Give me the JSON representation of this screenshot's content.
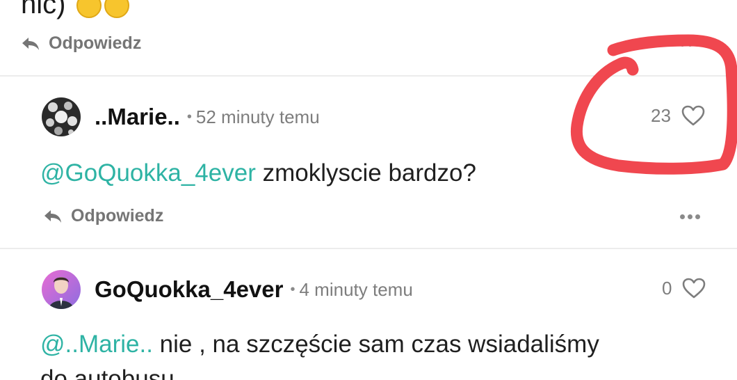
{
  "top_comment": {
    "text_fragment": "nic)",
    "emoji_icons": [
      "relieved-face-icon",
      "smiling-face-icon"
    ],
    "reply_label": "Odpowiedz"
  },
  "comments": [
    {
      "username": "..Marie..",
      "separator": "•",
      "time": "52 minuty temu",
      "likes": "23",
      "mention": "@GoQuokka_4ever",
      "text": " zmoklyscie bardzo?",
      "reply_label": "Odpowiedz"
    },
    {
      "username": "GoQuokka_4ever",
      "separator": "•",
      "time": "4 minuty temu",
      "likes": "0",
      "mention": "@..Marie..",
      "text": " nie , na szczęście sam czas wsiadaliśmy",
      "text_line2": "do autobusu"
    }
  ],
  "annotation": {
    "color": "#f0474f",
    "shape": "hand-drawn-circle"
  },
  "colors": {
    "mention": "#2eb3a4",
    "muted": "#7d7d7d",
    "divider": "#ececec"
  }
}
